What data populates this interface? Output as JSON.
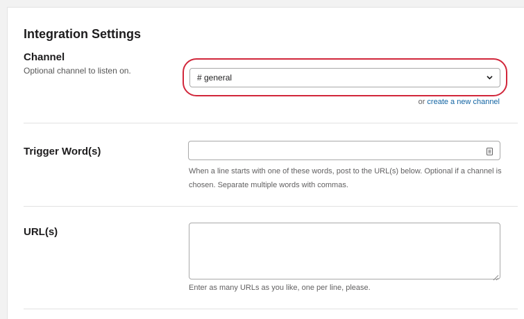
{
  "page": {
    "title": "Integration Settings"
  },
  "channel": {
    "label": "Channel",
    "description": "Optional channel to listen on.",
    "selected": "# general",
    "or_text": "or ",
    "create_link": "create a new channel"
  },
  "trigger": {
    "label": "Trigger Word(s)",
    "value": "",
    "help": "When a line starts with one of these words, post to the URL(s) below. Optional if a channel is chosen. Separate multiple words with commas."
  },
  "urls": {
    "label": "URL(s)",
    "value": "",
    "help": "Enter as many URLs as you like, one per line, please."
  },
  "colors": {
    "highlight": "#d1263a",
    "link": "#1264a3"
  },
  "icons": {
    "select": "chevron-down-icon",
    "trigger": "list-icon",
    "textarea": "resize-grip-icon"
  }
}
